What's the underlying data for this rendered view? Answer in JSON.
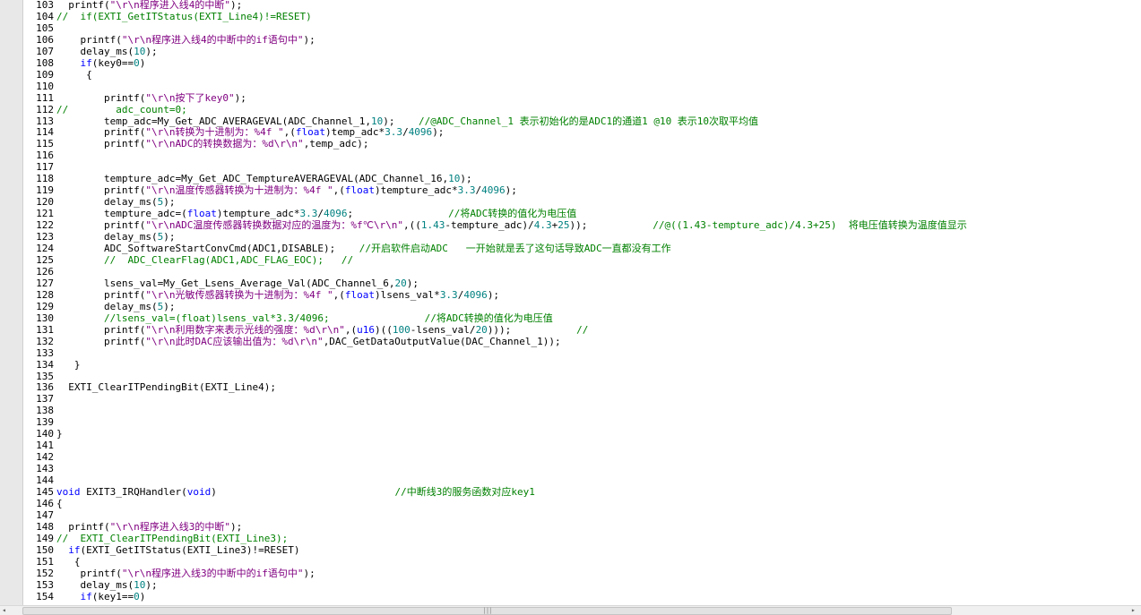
{
  "editor": {
    "lines": [
      {
        "n": "103",
        "t": "  printf(\"\\r\\n程序进入线4的中断\");"
      },
      {
        "n": "104",
        "t": "//  if(EXTI_GetITStatus(EXTI_Line4)!=RESET)"
      },
      {
        "n": "105",
        "t": ""
      },
      {
        "n": "106",
        "t": "    printf(\"\\r\\n程序进入线4的中断中的if语句中\");"
      },
      {
        "n": "107",
        "t": "    delay_ms(10);"
      },
      {
        "n": "108",
        "t": "    if(key0==0)"
      },
      {
        "n": "109",
        "t": "     {"
      },
      {
        "n": "110",
        "t": ""
      },
      {
        "n": "111",
        "t": "        printf(\"\\r\\n按下了key0\");"
      },
      {
        "n": "112",
        "t": "//        adc_count=0;"
      },
      {
        "n": "113",
        "t": "        temp_adc=My_Get_ADC_AVERAGEVAL(ADC_Channel_1,10);    //@ADC_Channel_1 表示初始化的是ADC1的通道1 @10 表示10次取平均值"
      },
      {
        "n": "114",
        "t": "        printf(\"\\r\\n转换为十进制为：%4f \",(float)temp_adc*3.3/4096);"
      },
      {
        "n": "115",
        "t": "        printf(\"\\r\\nADC的转换数据为：%d\\r\\n\",temp_adc);"
      },
      {
        "n": "116",
        "t": ""
      },
      {
        "n": "117",
        "t": ""
      },
      {
        "n": "118",
        "t": "        tempture_adc=My_Get_ADC_TemptureAVERAGEVAL(ADC_Channel_16,10);"
      },
      {
        "n": "119",
        "t": "        printf(\"\\r\\n温度传感器转换为十进制为：%4f \",(float)tempture_adc*3.3/4096);"
      },
      {
        "n": "120",
        "t": "        delay_ms(5);"
      },
      {
        "n": "121",
        "t": "        tempture_adc=(float)tempture_adc*3.3/4096;                //将ADC转换的值化为电压值"
      },
      {
        "n": "122",
        "t": "        printf(\"\\r\\nADC温度传感器转换数据对应的温度为：%f℃\\r\\n\",((1.43-tempture_adc)/4.3+25));           //@((1.43-tempture_adc)/4.3+25)  将电压值转换为温度值显示"
      },
      {
        "n": "123",
        "t": "        delay_ms(5);"
      },
      {
        "n": "124",
        "t": "        ADC_SoftwareStartConvCmd(ADC1,DISABLE);    //开启软件启动ADC   一开始就是丢了这句话导致ADC一直都没有工作"
      },
      {
        "n": "125",
        "t": "        //  ADC_ClearFlag(ADC1,ADC_FLAG_EOC);   //"
      },
      {
        "n": "126",
        "t": ""
      },
      {
        "n": "127",
        "t": "        lsens_val=My_Get_Lsens_Average_Val(ADC_Channel_6,20);"
      },
      {
        "n": "128",
        "t": "        printf(\"\\r\\n光敏传感器转换为十进制为：%4f \",(float)lsens_val*3.3/4096);"
      },
      {
        "n": "129",
        "t": "        delay_ms(5);"
      },
      {
        "n": "130",
        "t": "        //lsens_val=(float)lsens_val*3.3/4096;                //将ADC转换的值化为电压值"
      },
      {
        "n": "131",
        "t": "        printf(\"\\r\\n利用数字来表示光线的强度：%d\\r\\n\",(u16)((100-lsens_val/20)));           //"
      },
      {
        "n": "132",
        "t": "        printf(\"\\r\\n此时DAC应该输出值为：%d\\r\\n\",DAC_GetDataOutputValue(DAC_Channel_1));"
      },
      {
        "n": "133",
        "t": ""
      },
      {
        "n": "134",
        "t": "   }"
      },
      {
        "n": "135",
        "t": ""
      },
      {
        "n": "136",
        "t": "  EXTI_ClearITPendingBit(EXTI_Line4);"
      },
      {
        "n": "137",
        "t": ""
      },
      {
        "n": "138",
        "t": ""
      },
      {
        "n": "139",
        "t": ""
      },
      {
        "n": "140",
        "t": "}"
      },
      {
        "n": "141",
        "t": ""
      },
      {
        "n": "142",
        "t": ""
      },
      {
        "n": "143",
        "t": ""
      },
      {
        "n": "144",
        "t": ""
      },
      {
        "n": "145",
        "t": "void EXIT3_IRQHandler(void)                              //中断线3的服务函数对应key1"
      },
      {
        "n": "146",
        "t": "{"
      },
      {
        "n": "147",
        "t": ""
      },
      {
        "n": "148",
        "t": "  printf(\"\\r\\n程序进入线3的中断\");"
      },
      {
        "n": "149",
        "t": "//  EXTI_ClearITPendingBit(EXTI_Line3);"
      },
      {
        "n": "150",
        "t": "  if(EXTI_GetITStatus(EXTI_Line3)!=RESET)"
      },
      {
        "n": "151",
        "t": "   {"
      },
      {
        "n": "152",
        "t": "    printf(\"\\r\\n程序进入线3的中断中的if语句中\");"
      },
      {
        "n": "153",
        "t": "    delay_ms(10);"
      },
      {
        "n": "154",
        "t": "    if(key1==0)"
      }
    ]
  },
  "scrollbar": {
    "left_arrow": "◂",
    "right_arrow": "▸",
    "grip": "|||"
  }
}
